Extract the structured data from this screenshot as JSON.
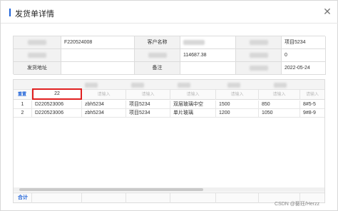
{
  "dialog": {
    "title": "发货单详情",
    "close_glyph": "✕"
  },
  "info": {
    "row1": {
      "label1": "",
      "value1": "F220524008",
      "label2": "客户名称",
      "value2": "",
      "label3": "",
      "value3": "项目5234"
    },
    "row2": {
      "label1": "",
      "value1": "",
      "label2": "",
      "value2": "114687.38",
      "label3": "",
      "value3": "0"
    },
    "row3": {
      "label1": "发货地址",
      "value1": "",
      "label2": "备注",
      "value2": "",
      "label3": "",
      "value3": "2022-05-24"
    }
  },
  "grid": {
    "reset_label": "重置",
    "filter_value": "22",
    "filter_placeholder": "请输入",
    "rows": [
      {
        "index": "1",
        "code": "D220523006",
        "user": "zbh5234",
        "project": "项目5234",
        "product": "双层玻璃中空",
        "qty": "1500",
        "price": "850",
        "spec": "8#5-5"
      },
      {
        "index": "2",
        "code": "D220523006",
        "user": "zbh5234",
        "project": "项目5234",
        "product": "单片玻璃",
        "qty": "1200",
        "price": "1050",
        "spec": "9#8-9"
      }
    ]
  },
  "footer": {
    "total_label": "合计"
  },
  "watermark": "CSDN @藝珏/Herzz"
}
